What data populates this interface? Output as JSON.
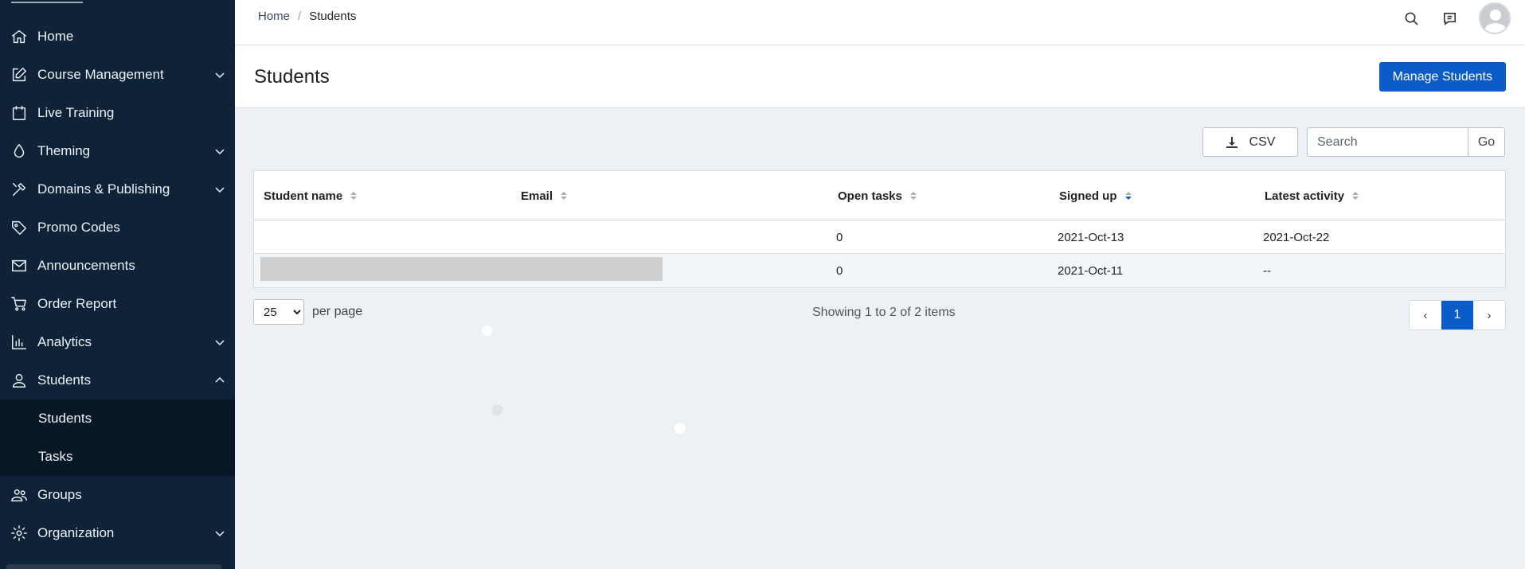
{
  "sidebar": {
    "items": [
      {
        "label": "Home",
        "icon": "home-icon",
        "expandable": false
      },
      {
        "label": "Course Management",
        "icon": "edit-icon",
        "expandable": true
      },
      {
        "label": "Live Training",
        "icon": "calendar-icon",
        "expandable": false
      },
      {
        "label": "Theming",
        "icon": "droplet-icon",
        "expandable": true
      },
      {
        "label": "Domains & Publishing",
        "icon": "tools-icon",
        "expandable": true
      },
      {
        "label": "Promo Codes",
        "icon": "tag-icon",
        "expandable": false
      },
      {
        "label": "Announcements",
        "icon": "mail-icon",
        "expandable": false
      },
      {
        "label": "Order Report",
        "icon": "cart-icon",
        "expandable": false
      },
      {
        "label": "Analytics",
        "icon": "bar-chart-icon",
        "expandable": true
      },
      {
        "label": "Students",
        "icon": "user-icon",
        "expandable": true,
        "expanded": true
      },
      {
        "label": "Groups",
        "icon": "users-icon",
        "expandable": false
      },
      {
        "label": "Organization",
        "icon": "gear-icon",
        "expandable": true
      }
    ],
    "students_sub": [
      "Students",
      "Tasks"
    ]
  },
  "breadcrumb": {
    "home": "Home",
    "separator": "/",
    "current": "Students"
  },
  "header": {
    "title": "Students",
    "manage_button": "Manage Students"
  },
  "toolbar": {
    "csv_label": "CSV",
    "search_placeholder": "Search",
    "go_label": "Go"
  },
  "table": {
    "columns": [
      "Student name",
      "Email",
      "Open tasks",
      "Signed up",
      "Latest activity"
    ],
    "sorted_column": "Signed up",
    "rows": [
      {
        "name": "",
        "email": "",
        "open_tasks": "0",
        "signed_up": "2021-Oct-13",
        "latest_activity": "2021-Oct-22"
      },
      {
        "name": "",
        "email": "",
        "open_tasks": "0",
        "signed_up": "2021-Oct-11",
        "latest_activity": "--"
      }
    ]
  },
  "footer": {
    "per_page_value": "25",
    "per_page_options": [
      "25"
    ],
    "per_page_label": "per page",
    "showing_text": "Showing 1 to 2 of 2 items",
    "prev": "‹",
    "current_page": "1",
    "next": "›"
  },
  "colors": {
    "sidebar_bg": "#0e2238",
    "accent": "#0b5bc8",
    "page_bg": "#edf1f5"
  }
}
